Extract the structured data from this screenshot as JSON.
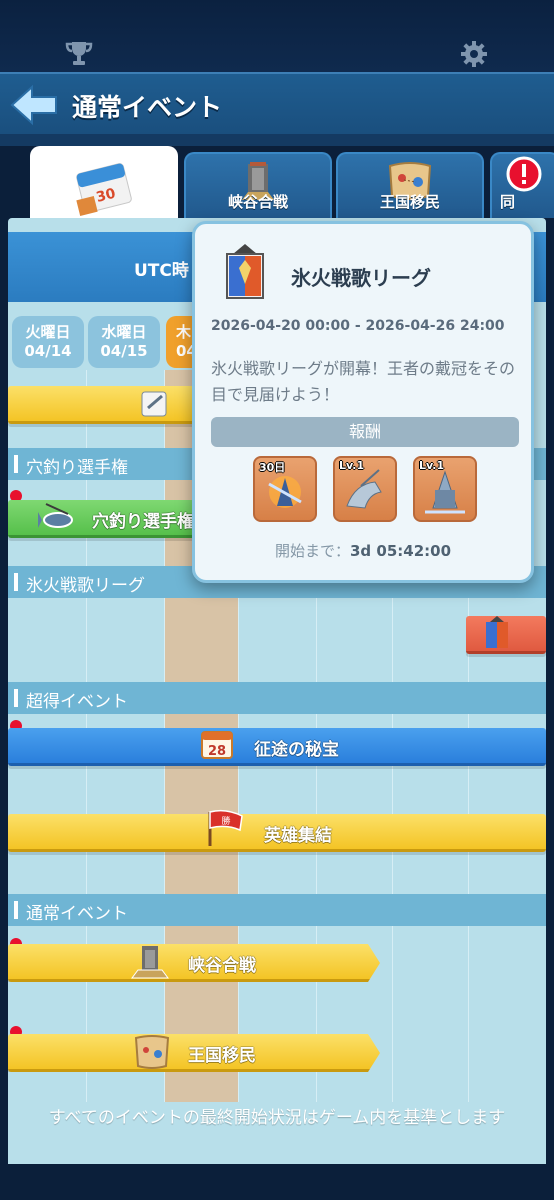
{
  "header": {
    "title": "通常イベント"
  },
  "tabs": [
    {
      "label": "",
      "icon": "calendar-icon",
      "badge_number": "30"
    },
    {
      "label": "峡谷合戦",
      "icon": "canyon-tower-icon"
    },
    {
      "label": "王国移民",
      "icon": "map-scroll-icon"
    },
    {
      "label": "同",
      "icon": "alert-icon"
    }
  ],
  "timeline": {
    "utc_label": "UTC時",
    "days": [
      {
        "weekday": "火曜日",
        "date": "04/14"
      },
      {
        "weekday": "水曜日",
        "date": "04/15"
      },
      {
        "weekday": "木",
        "date": "04"
      }
    ],
    "sections": [
      {
        "label": "穴釣り選手権"
      },
      {
        "label": "氷火戦歌リーグ"
      },
      {
        "label": "超得イベント"
      },
      {
        "label": "通常イベント"
      }
    ],
    "events": {
      "top_partial": "",
      "fishing": "穴釣り選手権",
      "expedition": "征途の秘宝",
      "expedition_badge": "28",
      "heroes": "英雄集結",
      "heroes_flag": "勝",
      "canyon": "峡谷合戦",
      "migration": "王国移民"
    }
  },
  "popup": {
    "title": "氷火戦歌リーグ",
    "dates": "2026-04-20 00:00 - 2026-04-26 24:00",
    "description": "氷火戦歌リーグが開幕！王者の戴冠をその目で見届けよう！",
    "reward_label": "報酬",
    "rewards": [
      {
        "tag": "30日"
      },
      {
        "tag": "Lv.1"
      },
      {
        "tag": "Lv.1"
      }
    ],
    "start_prefix": "開始まで：",
    "start_time": "3d 05:42:00"
  },
  "footer": {
    "note": "すべてのイベントの最終開始状況はゲーム内を基準とします"
  },
  "colors": {
    "accent_blue": "#2b7cc0",
    "bar_yellow": "#f4c425",
    "alert_red": "#e8102e",
    "today_orange": "#f0a02c"
  }
}
